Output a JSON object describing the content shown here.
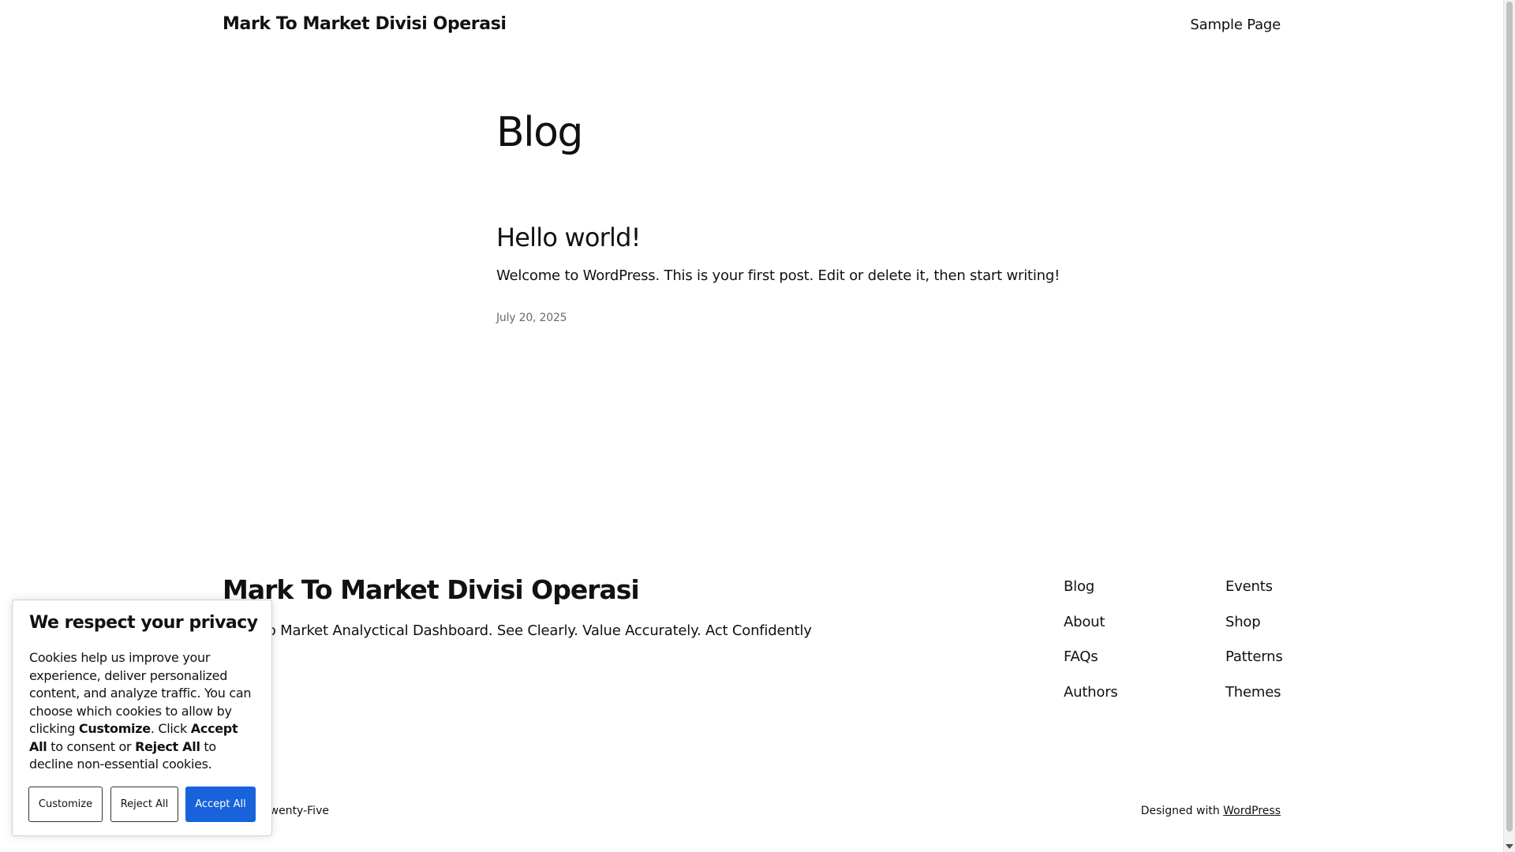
{
  "header": {
    "site_title": "Mark To Market Divisi Operasi",
    "nav_items": [
      "Sample Page"
    ]
  },
  "main": {
    "page_title": "Blog",
    "posts": [
      {
        "title": "Hello world!",
        "excerpt": "Welcome to WordPress. This is your first post. Edit or delete it, then start writing!",
        "date": "July 20, 2025"
      }
    ]
  },
  "footer": {
    "title": "Mark To Market Divisi Operasi",
    "tagline": "Mark To Market Analyctical Dashboard. See Clearly. Value Accurately. Act Confidently",
    "nav_col_1": [
      "Blog",
      "About",
      "FAQs",
      "Authors"
    ],
    "nav_col_2": [
      "Events",
      "Shop",
      "Patterns",
      "Themes"
    ],
    "theme_credit": "Twenty Twenty-Five",
    "designed_with": "Designed with",
    "designed_link": "WordPress"
  },
  "cookie": {
    "heading": "We respect your privacy",
    "text_1": "Cookies help us improve your experience, deliver personalized content, and analyze traffic. You can choose which cookies to allow by clicking ",
    "bold_customize": "Customize",
    "text_2": ". Click ",
    "bold_accept": "Accept All",
    "text_3": " to consent or ",
    "bold_reject": "Reject All",
    "text_4": " to decline non-essential cookies.",
    "btn_customize": "Customize",
    "btn_reject": "Reject All",
    "btn_accept": "Accept All",
    "accent_color": "#1863dc"
  }
}
